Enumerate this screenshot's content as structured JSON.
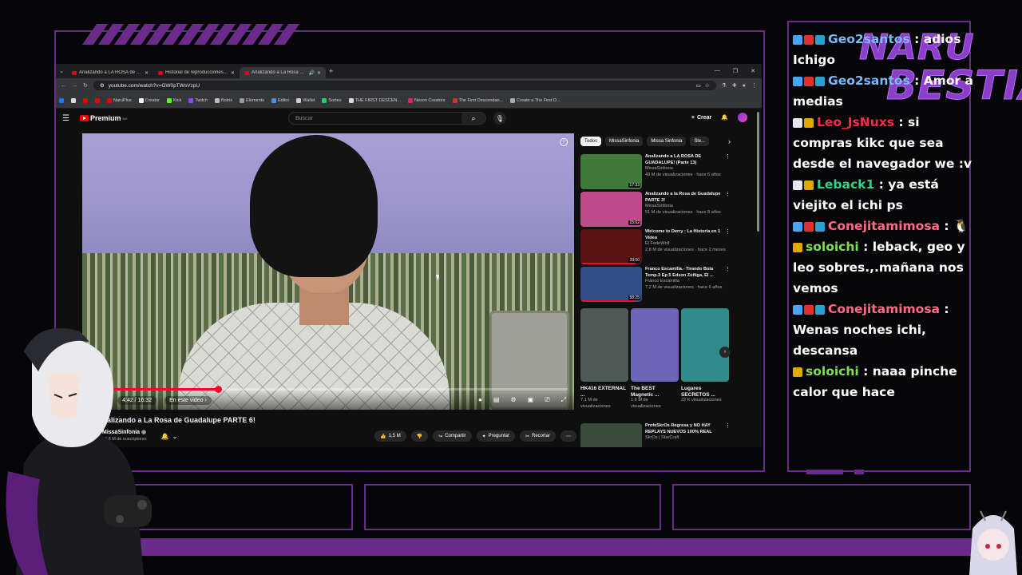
{
  "overlay": {
    "logo_line1": "NARU",
    "logo_line2": "BESTIA",
    "accent": "#6a2b8a"
  },
  "browser": {
    "tabs": [
      {
        "title": "Analizando a LA ROSA de GUADAL...",
        "active": false
      },
      {
        "title": "Historial de reproducciones - Yo...",
        "active": false
      },
      {
        "title": "Analizando a La Rosa de Gu...",
        "active": true
      }
    ],
    "url": "youtube.com/watch?v=GW0pTWsVzpU",
    "bookmarks": [
      "NaruPlus",
      "Creator",
      "Kick",
      "Twitch",
      "Botrix",
      "Elements",
      "Editor",
      "Wallet",
      "Sorteo",
      "THE FIRST DESCEN...",
      "Nexon Creators",
      "The First Descendan...",
      "Create a The First D..."
    ]
  },
  "youtube": {
    "logo": "Premium",
    "logo_region": "MX",
    "search_placeholder": "Buscar",
    "create_label": "Crear",
    "video": {
      "progress": 0.27,
      "time": "4:42 / 16:32",
      "chapter_chip": "En este video",
      "title": "Analizando a La Rosa de Guadalupe PARTE 6!",
      "channel": "MissaSinfonia",
      "subscribers": "20,8 M de suscriptores",
      "likes": "1,5 M",
      "share": "Compartir",
      "ask": "Preguntar",
      "clip": "Recortar"
    },
    "chips": [
      "Todos",
      "MissaSinfonia",
      "Missa Sinfonia",
      "Sle..."
    ],
    "recommendations": [
      {
        "title": "Analizando a LA ROSA DE GUADALUPE! (Parte 13)",
        "channel": "MissaSinfonia",
        "meta": "49 M de visualizaciones · hace 6 años",
        "duration": "17:33",
        "thumb": "#3f7a3a",
        "progress": 0
      },
      {
        "title": "Analizando a la Rosa de Guadalupe PARTE 3!",
        "channel": "MissaSinfonia",
        "meta": "51 M de visualizaciones · hace 8 años",
        "duration": "15:02",
        "thumb": "#c04b8c",
        "progress": 0
      },
      {
        "title": "Welcome to Derry : La Historia en 1 Video",
        "channel": "El FedeWolf",
        "meta": "2,8 M de visualizaciones · hace 2 meses",
        "duration": "39:00",
        "thumb": "#5a1212",
        "progress": 0.9
      },
      {
        "title": "Franco Escamilla.- Tirando Bola Temp.3 Ep 5 Edson Zúñiga, El ...",
        "channel": "Franco Escamilla",
        "meta": "7,2 M de visualizaciones · hace 6 años",
        "duration": "58:25",
        "thumb": "#2f4f86",
        "progress": 0.9
      }
    ],
    "shorts": [
      {
        "title": "HK416 EXTERNAL ...",
        "views": "7,1 M de visualizaciones",
        "thumb": "#4e5a55"
      },
      {
        "title": "The BEST Magnetic ...",
        "views": "1,6 M de visualizaciones",
        "thumb": "#6c66b8"
      },
      {
        "title": "Lugares SECRETOS ...",
        "views": "22 K visualizaciones",
        "thumb": "#2f8a8a"
      }
    ],
    "last_rec": {
      "title": "ProfeSkrOs Regresa y NO HAY REPLAYS NUEVOS 100% REAL",
      "channel": "SkrOs | StarCraft",
      "thumb": "#3a4b3b"
    }
  },
  "chat": [
    {
      "user": "Geo2santos",
      "text": "adios Ichigo",
      "color": "#7ab8ff",
      "badges": [
        "#4aa3ff",
        "#e03030",
        "#2aa0d0"
      ]
    },
    {
      "user": "Geo2santos",
      "text": "Amor a medias",
      "color": "#7ab8ff",
      "badges": [
        "#4aa3ff",
        "#e03030",
        "#2aa0d0"
      ]
    },
    {
      "user": "Leo_JsNuxs",
      "text": "si compras kikc que sea desde el navegador we :v",
      "color": "#ff2a4a",
      "badges": [
        "#e6e6f0",
        "#e0a800"
      ]
    },
    {
      "user": "Leback1",
      "text": "ya está viejito el ichi ps",
      "color": "#2fd68a",
      "badges": [
        "#e6e6f0",
        "#e0a800"
      ]
    },
    {
      "user": "Conejitamimosa",
      "text": "🐧",
      "color": "#ff6a86",
      "badges": [
        "#4aa3ff",
        "#e03030",
        "#2aa0d0"
      ]
    },
    {
      "user": "soloichi",
      "text": "leback, geo y leo sobres.,.mañana nos vemos",
      "color": "#7ee04a",
      "badges": [
        "#e0a800"
      ]
    },
    {
      "user": "Conejitamimosa",
      "text": "Wenas noches ichi, descansa",
      "color": "#ff6a86",
      "badges": [
        "#4aa3ff",
        "#e03030",
        "#2aa0d0"
      ]
    },
    {
      "user": "soloichi",
      "text": "naaa pinche calor que hace",
      "color": "#7ee04a",
      "badges": [
        "#e0a800"
      ]
    }
  ]
}
